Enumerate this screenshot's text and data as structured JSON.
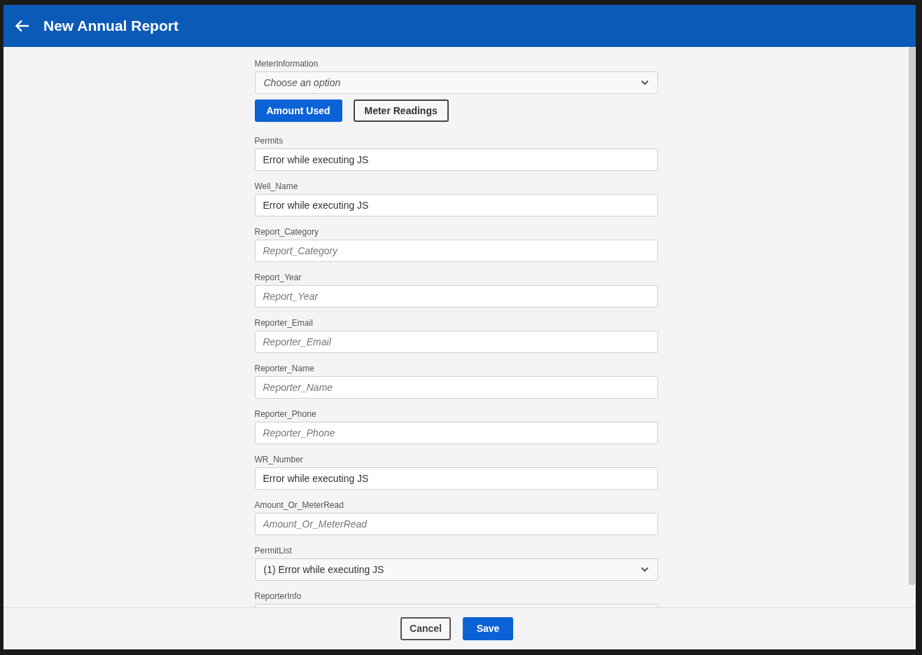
{
  "header": {
    "title": "New Annual Report"
  },
  "fields": [
    {
      "kind": "select",
      "label": "MeterInformation",
      "placeholder": "Choose an option"
    },
    {
      "kind": "toggle",
      "options": [
        {
          "label": "Amount Used",
          "selected": true
        },
        {
          "label": "Meter Readings",
          "selected": false
        }
      ]
    },
    {
      "kind": "text",
      "label": "Permits",
      "value": "Error while executing JS"
    },
    {
      "kind": "text",
      "label": "Well_Name",
      "value": "Error while executing JS"
    },
    {
      "kind": "text",
      "label": "Report_Category",
      "placeholder": "Report_Category"
    },
    {
      "kind": "text",
      "label": "Report_Year",
      "placeholder": "Report_Year"
    },
    {
      "kind": "text",
      "label": "Reporter_Email",
      "placeholder": "Reporter_Email"
    },
    {
      "kind": "text",
      "label": "Reporter_Name",
      "placeholder": "Reporter_Name"
    },
    {
      "kind": "text",
      "label": "Reporter_Phone",
      "placeholder": "Reporter_Phone"
    },
    {
      "kind": "text",
      "label": "WR_Number",
      "value": "Error while executing JS"
    },
    {
      "kind": "text",
      "label": "Amount_Or_MeterRead",
      "placeholder": "Amount_Or_MeterRead"
    },
    {
      "kind": "select",
      "label": "PermitList",
      "value": "(1) Error while executing JS"
    },
    {
      "kind": "select",
      "label": "ReporterInfo"
    }
  ],
  "footer": {
    "buttons": [
      {
        "kind": "secondary",
        "label": "Cancel"
      },
      {
        "kind": "primary",
        "label": "Save"
      }
    ]
  }
}
